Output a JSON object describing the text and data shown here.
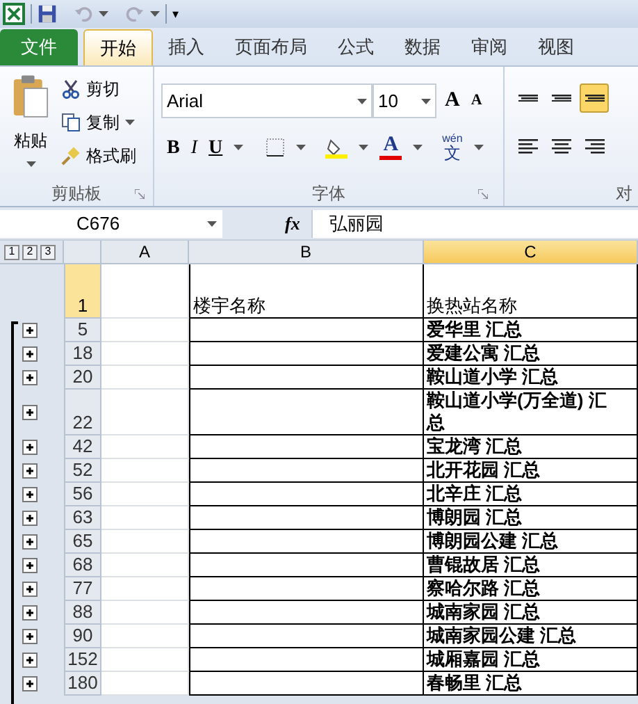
{
  "quick_access": {
    "more": "▾"
  },
  "tabs": [
    {
      "label": "文件",
      "kind": "file",
      "selected": false
    },
    {
      "label": "开始",
      "kind": "tab",
      "selected": true
    },
    {
      "label": "插入",
      "kind": "tab",
      "selected": false
    },
    {
      "label": "页面布局",
      "kind": "tab",
      "selected": false
    },
    {
      "label": "公式",
      "kind": "tab",
      "selected": false
    },
    {
      "label": "数据",
      "kind": "tab",
      "selected": false
    },
    {
      "label": "审阅",
      "kind": "tab",
      "selected": false
    },
    {
      "label": "视图",
      "kind": "tab",
      "selected": false
    }
  ],
  "clipboard": {
    "paste": "粘贴",
    "cut": "剪切",
    "copy": "复制",
    "format_painter": "格式刷",
    "title": "剪贴板"
  },
  "font": {
    "font_name": "Arial",
    "font_size": "10",
    "grow": "A",
    "shrink": "A",
    "bold": "B",
    "italic": "I",
    "underline": "U",
    "font_color": "A",
    "phonetic_top": "wén",
    "phonetic_bottom": "文",
    "title": "字体"
  },
  "alignment": {
    "title": "对",
    "buttons": [
      {
        "kind": "top",
        "selected": false
      },
      {
        "kind": "middle",
        "selected": false
      },
      {
        "kind": "bottom",
        "selected": true
      },
      {
        "kind": "left",
        "selected": false
      },
      {
        "kind": "center",
        "selected": false
      },
      {
        "kind": "right",
        "selected": false
      }
    ]
  },
  "formula_bar": {
    "name_box": "C676",
    "function_label": "fx",
    "value": "弘丽园"
  },
  "outline_levels": [
    "1",
    "2",
    "3"
  ],
  "columns": [
    {
      "label": "A",
      "selected": false
    },
    {
      "label": "B",
      "selected": false
    },
    {
      "label": "C",
      "selected": true
    }
  ],
  "rows": [
    {
      "number": "1",
      "kind": "header",
      "selected": true,
      "b": "楼宇名称",
      "c": "换热站名称"
    },
    {
      "number": "5",
      "kind": "group",
      "selected": false,
      "expanded": false,
      "c": "爱华里 汇总"
    },
    {
      "number": "18",
      "kind": "group",
      "selected": false,
      "expanded": false,
      "c": "爱建公寓 汇总"
    },
    {
      "number": "20",
      "kind": "group",
      "selected": false,
      "expanded": false,
      "c": "鞍山道小学 汇总"
    },
    {
      "number": "22",
      "kind": "group",
      "selected": false,
      "expanded": false,
      "c": "鞍山道小学(万全道) 汇总"
    },
    {
      "number": "42",
      "kind": "group",
      "selected": false,
      "expanded": false,
      "c": "宝龙湾 汇总"
    },
    {
      "number": "52",
      "kind": "group",
      "selected": false,
      "expanded": false,
      "c": "北开花园 汇总"
    },
    {
      "number": "56",
      "kind": "group",
      "selected": false,
      "expanded": false,
      "c": "北辛庄 汇总"
    },
    {
      "number": "63",
      "kind": "group",
      "selected": false,
      "expanded": false,
      "c": "博朗园 汇总"
    },
    {
      "number": "65",
      "kind": "group",
      "selected": false,
      "expanded": false,
      "c": "博朗园公建 汇总"
    },
    {
      "number": "68",
      "kind": "group",
      "selected": false,
      "expanded": false,
      "c": "曹锟故居 汇总"
    },
    {
      "number": "77",
      "kind": "group",
      "selected": false,
      "expanded": false,
      "c": "察哈尔路 汇总"
    },
    {
      "number": "88",
      "kind": "group",
      "selected": false,
      "expanded": false,
      "c": "城南家园 汇总"
    },
    {
      "number": "90",
      "kind": "group",
      "selected": false,
      "expanded": false,
      "c": "城南家园公建 汇总"
    },
    {
      "number": "152",
      "kind": "group",
      "selected": false,
      "expanded": false,
      "c": "城厢嘉园 汇总"
    },
    {
      "number": "180",
      "kind": "group",
      "selected": false,
      "expanded": false,
      "c": "春畅里 汇总"
    }
  ]
}
